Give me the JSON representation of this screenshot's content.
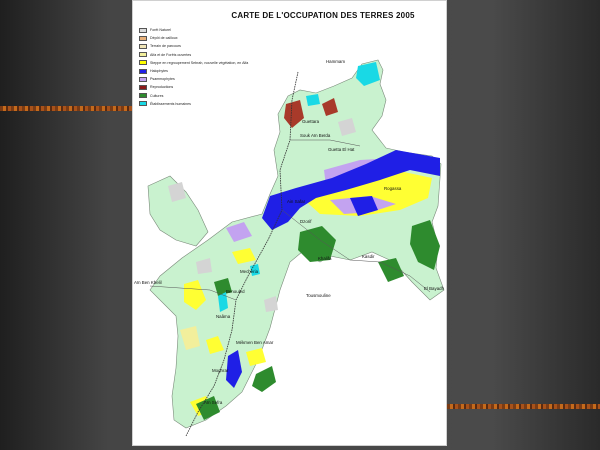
{
  "map": {
    "title": "CARTE DE L'OCCUPATION DES TERRES 2005",
    "legend": [
      {
        "label": "Forêt Naturel",
        "color": "#dcdcdc"
      },
      {
        "label": "Dépôt de cailloux",
        "color": "#e9b27c"
      },
      {
        "label": "Terrain de parcours",
        "color": "#f1e6b8"
      },
      {
        "label": "Alfa et de Forêts ouvertes",
        "color": "#f2ef9c"
      },
      {
        "label": "Steppe en regroupement  Sebrah, nouvelle végétation, en Alfa",
        "color": "#ffff00"
      },
      {
        "label": "Halophytes",
        "color": "#1f1fe6"
      },
      {
        "label": "Psammophytes",
        "color": "#c3a3f0"
      },
      {
        "label": "Reproductions",
        "color": "#8b1a1a"
      },
      {
        "label": "Cultures",
        "color": "#2e8b2e"
      },
      {
        "label": "Établissements humaines",
        "color": "#19d9e5"
      }
    ],
    "places": [
      "Hammam",
      "Guettara",
      "Souk Aïn Beïda",
      "Guetta El Hat",
      "Ain Safar",
      "Rogassa",
      "Dzorif",
      "Khalifa",
      "Kasdir",
      "Mecheria",
      "El Bayadh",
      "Benouled",
      "Aïn Ben Khelil",
      "Tousmouline",
      "Naâma",
      "Mékmen Ben Amar",
      "Moghrar",
      "Aïn Sefra"
    ]
  }
}
